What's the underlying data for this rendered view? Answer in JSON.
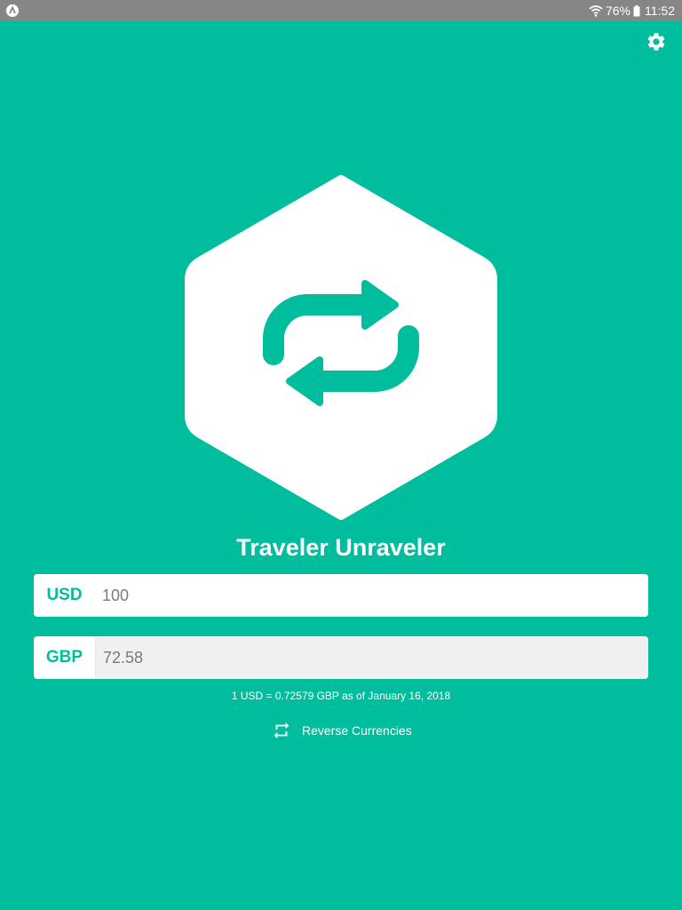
{
  "status_bar": {
    "battery_percent": "76%",
    "time": "11:52",
    "left_icon": "notification-app-icon",
    "wifi_icon": "wifi-icon",
    "battery_icon": "battery-icon"
  },
  "header": {
    "settings_icon": "gear-icon"
  },
  "logo": {
    "icon": "swap-arrows-icon",
    "background_color": "#ffffff",
    "icon_color": "#00bd9d"
  },
  "title": "Traveler Unraveler",
  "converter": {
    "base": {
      "code": "USD",
      "value": "100"
    },
    "quote": {
      "code": "GBP",
      "value": "72.58"
    },
    "rate_text": "1 USD = 0.72579 GBP as of January 16, 2018"
  },
  "reverse": {
    "label": "Reverse Currencies",
    "icon": "repeat-icon"
  },
  "colors": {
    "primary": "#00bd9d",
    "status_bar": "#868686",
    "text_light": "#ffffff",
    "input_text": "#7a7a7a",
    "disabled_input_bg": "#f0f0f0"
  }
}
